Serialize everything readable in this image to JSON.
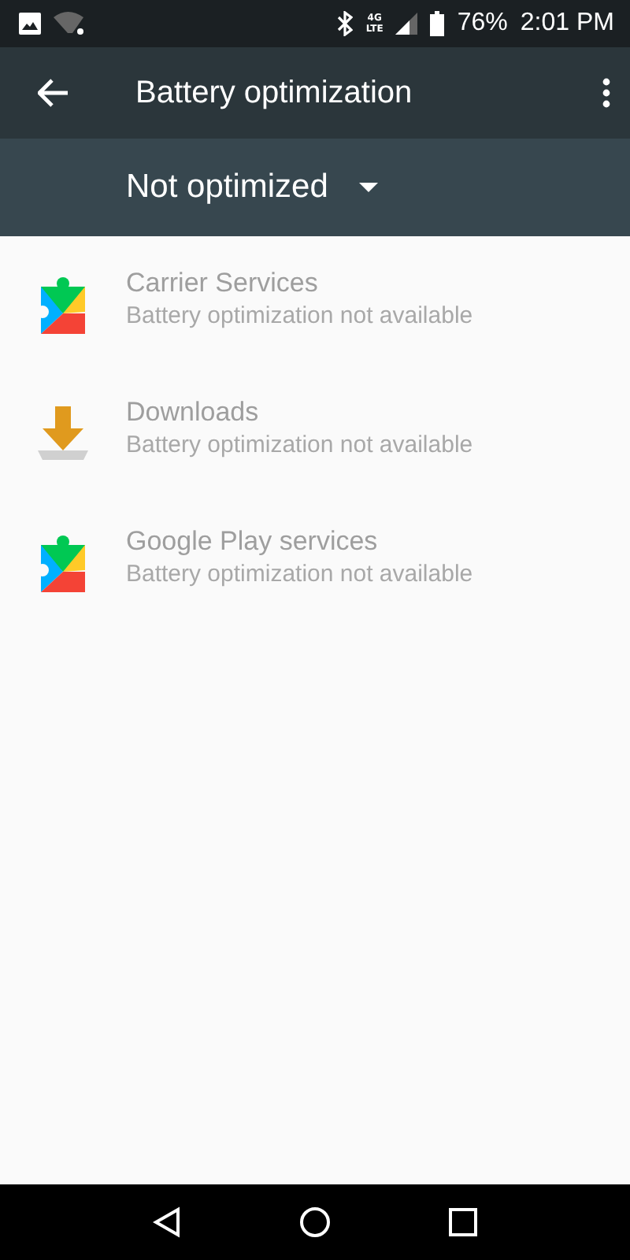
{
  "status_bar": {
    "network": [
      "4G",
      "LTE"
    ],
    "battery_percent": "76%",
    "time": "2:01 PM"
  },
  "app_bar": {
    "title": "Battery optimization"
  },
  "filter": {
    "value": "Not optimized"
  },
  "apps": [
    {
      "kind": "puzzle",
      "name": "Carrier Services",
      "status": "Battery optimization not available",
      "disabled": true
    },
    {
      "kind": "download",
      "name": "Downloads",
      "status": "Battery optimization not available",
      "disabled": true
    },
    {
      "kind": "puzzle",
      "name": "Google Play services",
      "status": "Battery optimization not available",
      "disabled": true
    }
  ]
}
